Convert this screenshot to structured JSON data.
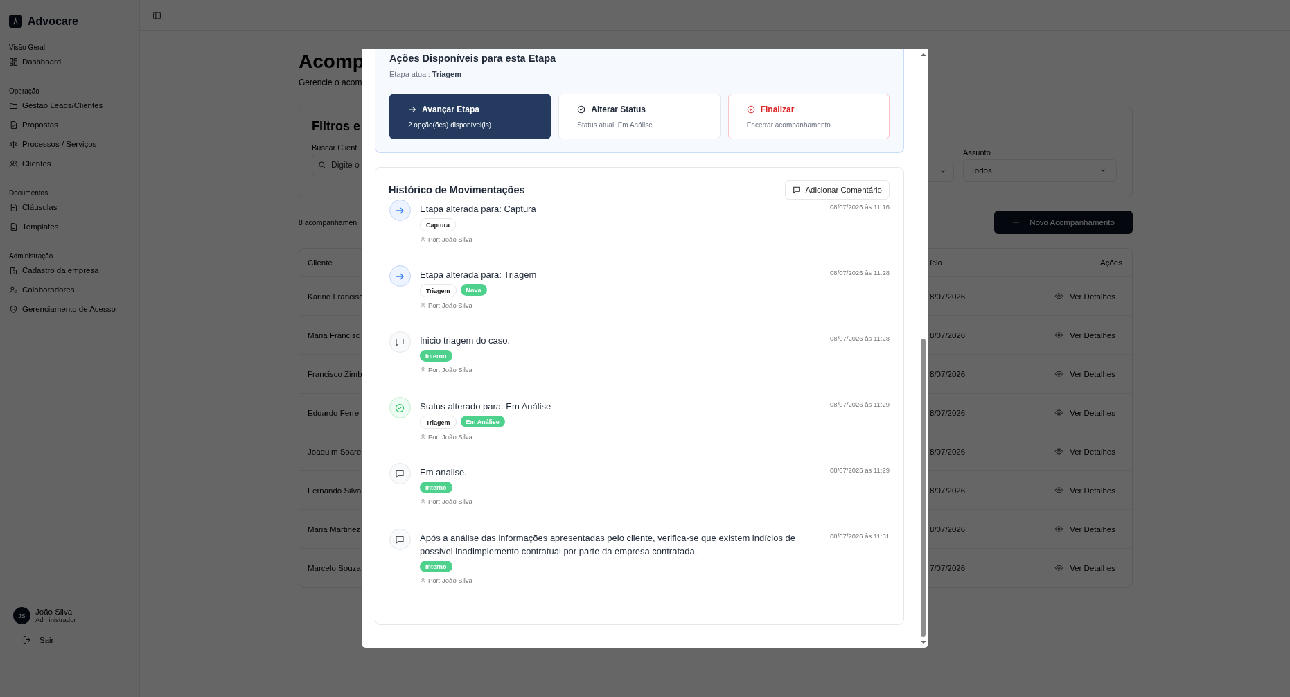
{
  "sidebar": {
    "brand": "Advocare",
    "sections": [
      {
        "title": "Visão Geral",
        "items": [
          "Dashboard"
        ]
      },
      {
        "title": "Operação",
        "items": [
          "Gestão Leads/Clientes",
          "Propostas",
          "Processos / Serviços",
          "Clientes"
        ]
      },
      {
        "title": "Documentos",
        "items": [
          "Cláusulas",
          "Templates"
        ]
      },
      {
        "title": "Administração",
        "items": [
          "Cadastro da empresa",
          "Colaboradores",
          "Gerenciamento de Acesso"
        ]
      }
    ],
    "user": {
      "initials": "JS",
      "name": "João Silva",
      "role": "Administrador"
    },
    "logout": "Sair"
  },
  "page": {
    "title": "Acomp",
    "subtitle": "Gerencie o acom",
    "filters": {
      "title": "Filtros e",
      "search_label": "Buscar Client",
      "search_placeholder": "Digite o",
      "subject_label": "Assunto",
      "subject_value": "Todos"
    },
    "count": "8 acompanhamen",
    "new_button": "Novo Acompanhamento",
    "table": {
      "column_1": "Cliente",
      "column_2": "ício",
      "actions": "Ações",
      "rows": [
        {
          "client": "Karine Francisc",
          "date": "8/07/2026",
          "action": "Ver Detalhes"
        },
        {
          "client": "Maria Francisc",
          "date": "8/07/2026",
          "action": "Ver Detalhes"
        },
        {
          "client": "Francisco Zimb",
          "date": "8/07/2026",
          "action": "Ver Detalhes"
        },
        {
          "client": "Eduardo Ferre",
          "date": "8/07/2026",
          "action": "Ver Detalhes"
        },
        {
          "client": "Joaquim Soare",
          "date": "8/07/2026",
          "action": "Ver Detalhes"
        },
        {
          "client": "Fernando Silva",
          "date": "8/07/2026",
          "action": "Ver Detalhes"
        },
        {
          "client": "Maria Martinez",
          "date": "8/07/2026",
          "action": "Ver Detalhes"
        },
        {
          "client": "Marcelo Souza",
          "date": "7/07/2026",
          "action": "Ver Detalhes"
        }
      ]
    }
  },
  "modal": {
    "actions": {
      "title": "Ações Disponíveis para esta Etapa",
      "stage": "Etapa atual: **Triagem**",
      "buttons": [
        {
          "kind": "primary",
          "label": "Avançar Etapa",
          "detail": "2 opção(ões) disponível(is)"
        },
        {
          "kind": "outline",
          "label": "Alterar Status",
          "detail": "Status atual: Em Análise"
        },
        {
          "kind": "danger",
          "label": "Finalizar",
          "detail": "Encerrar acompanhamento"
        }
      ]
    },
    "history": {
      "title": "Histórico de Movimentações",
      "add_button": "Adicionar Comentário",
      "events": [
        {
          "kind": "stage",
          "title": "Etapa alterada para: Captura",
          "date": "08/07/2026 às 11:16",
          "tags": [
            {
              "label": "Captura",
              "kind": "outline"
            }
          ],
          "author": "Por: João Silva"
        },
        {
          "kind": "stage",
          "title": "Etapa alterada para: Triagem",
          "date": "08/07/2026 às 11:28",
          "tags": [
            {
              "label": "Triagem",
              "kind": "outline"
            },
            {
              "label": "Nova",
              "kind": "green"
            }
          ],
          "author": "Por: João Silva"
        },
        {
          "kind": "comment",
          "title": "Inicio triagem do caso.",
          "date": "08/07/2026 às 11:28",
          "tags": [
            {
              "label": "Interno",
              "kind": "green"
            }
          ],
          "author": "Por: João Silva"
        },
        {
          "kind": "status",
          "title": "Status alterado para: Em Análise",
          "date": "08/07/2026 às 11:29",
          "tags": [
            {
              "label": "Triagem",
              "kind": "outline"
            },
            {
              "label": "Em Análise",
              "kind": "green"
            }
          ],
          "author": "Por: João Silva"
        },
        {
          "kind": "comment",
          "title": "Em analise.",
          "date": "08/07/2026 às 11:29",
          "tags": [
            {
              "label": "Interno",
              "kind": "green"
            }
          ],
          "author": "Por: João Silva"
        },
        {
          "kind": "comment",
          "title": "Após a análise das informações apresentadas pelo cliente, verifica-se que existem indícios de possível inadimplemento contratual por parte da empresa contratada.",
          "date": "08/07/2026 às 11:31",
          "tags": [
            {
              "label": "Interno",
              "kind": "green"
            }
          ],
          "author": "Por: João Silva"
        }
      ]
    }
  }
}
